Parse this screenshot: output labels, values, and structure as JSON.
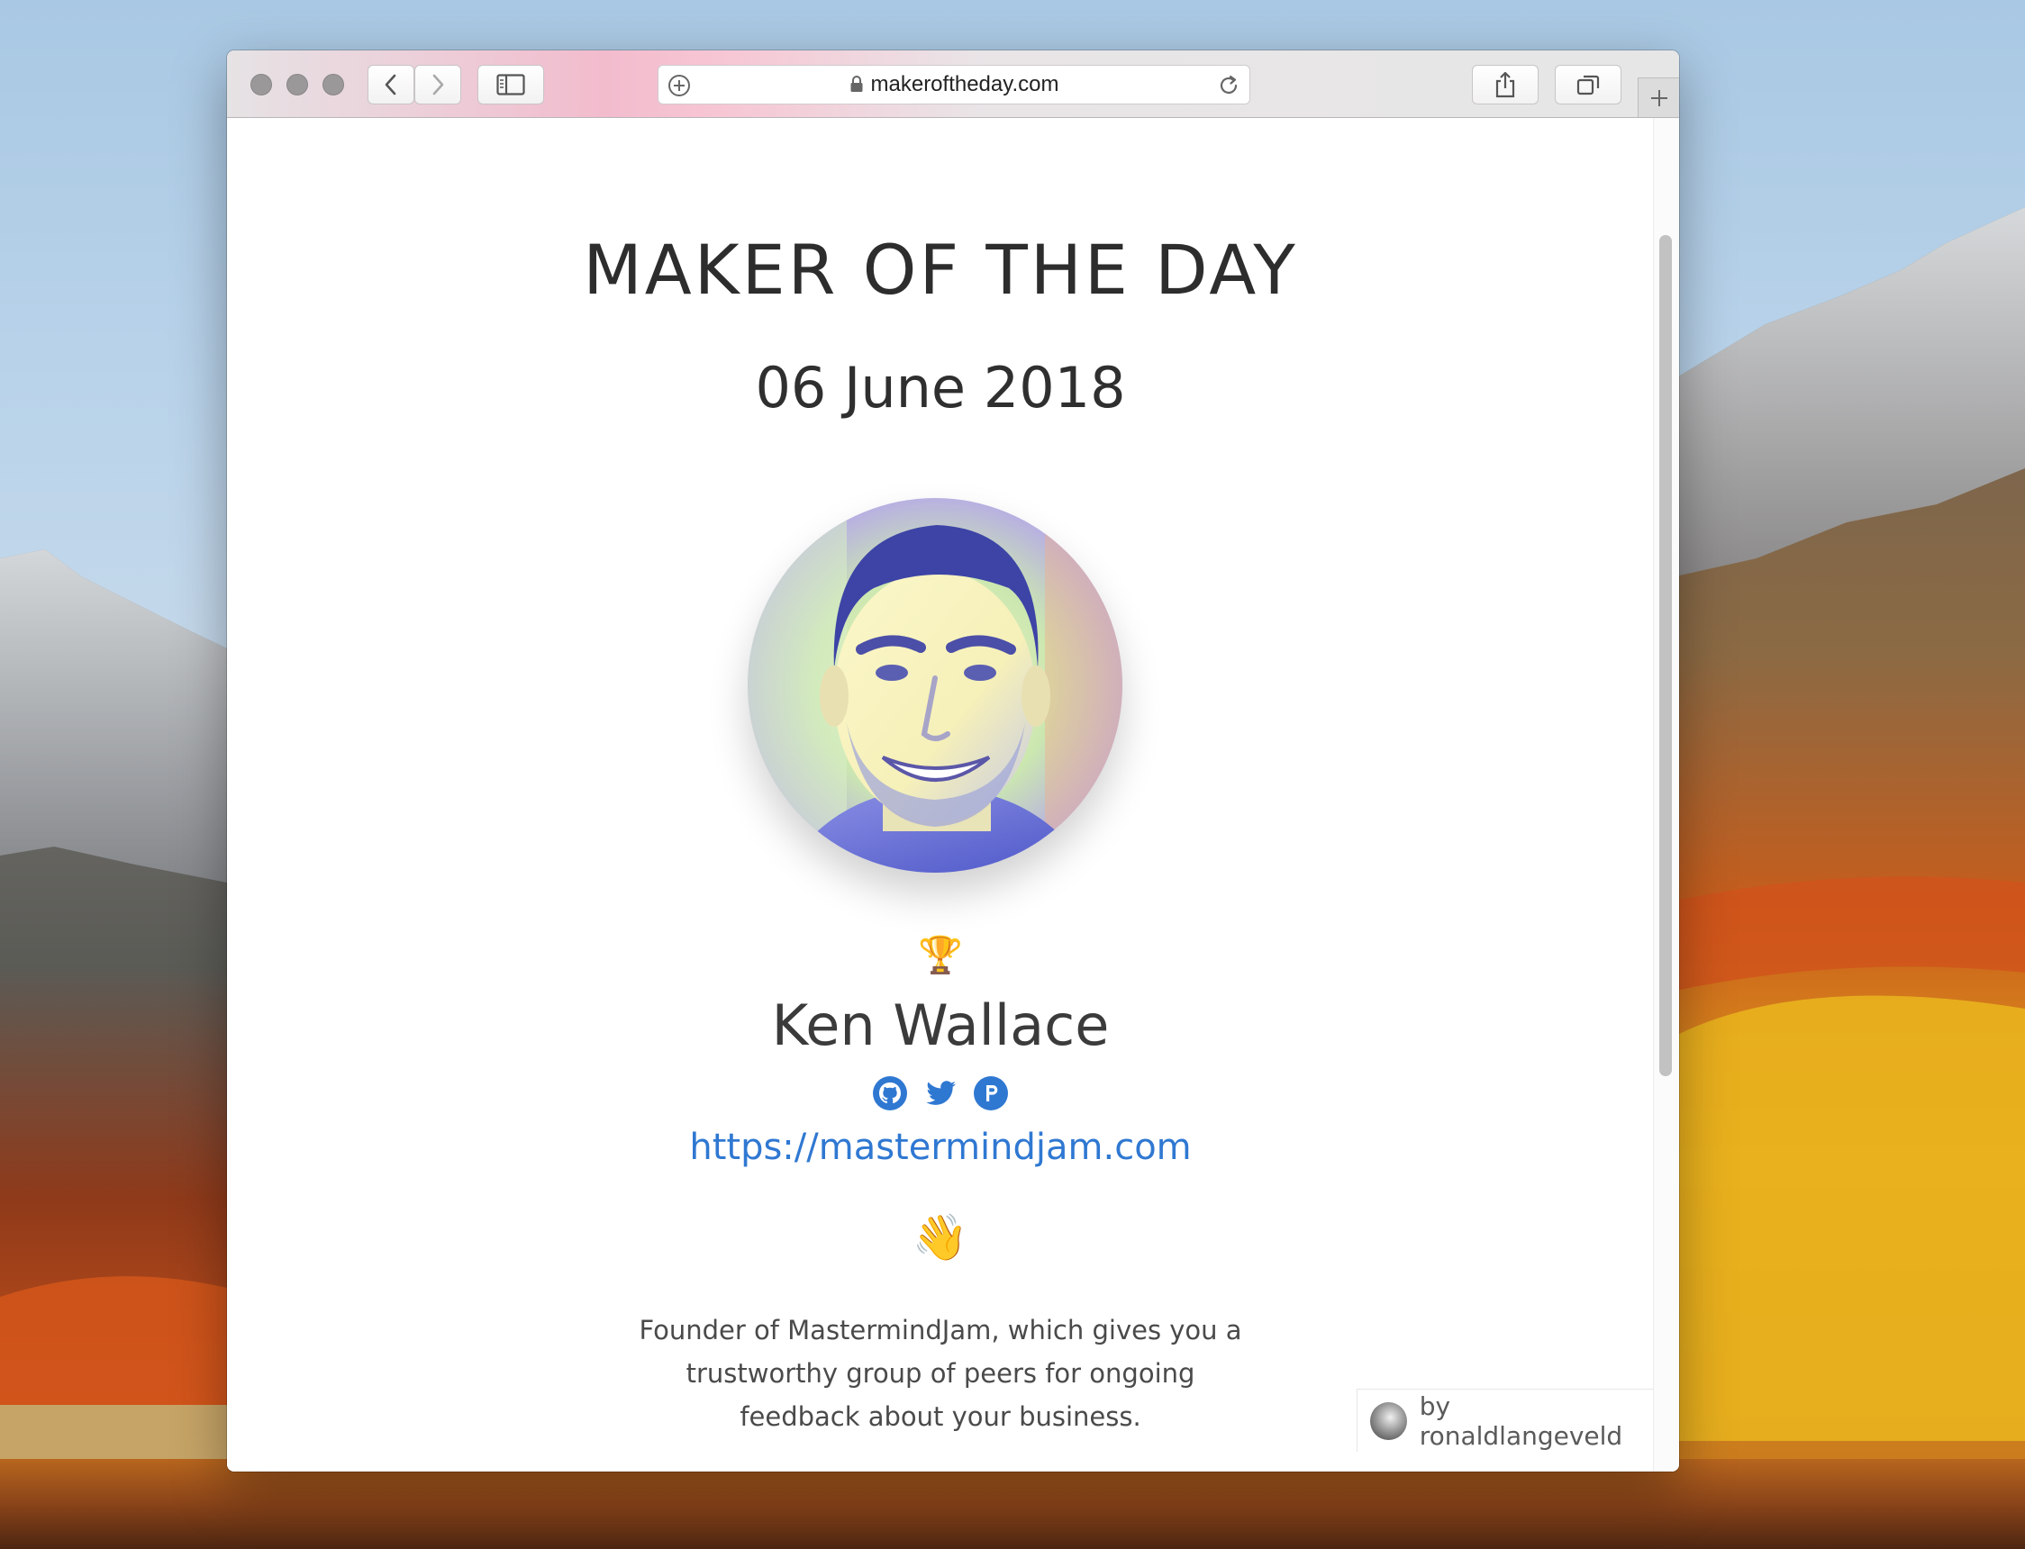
{
  "browser": {
    "url": "makeroftheday.com"
  },
  "page": {
    "title": "MAKER OF THE DAY",
    "date": "06 June 2018",
    "trophy": "🏆",
    "maker_name": "Ken Wallace",
    "maker_link": "https://mastermindjam.com",
    "wave": "👋",
    "bio": "Founder of MastermindJam, which gives you a trustworthy group of peers for ongoing feedback about your business.",
    "credit": "by ronaldlangeveld",
    "socials": [
      "github-icon",
      "twitter-icon",
      "producthunt-icon"
    ]
  },
  "colors": {
    "link": "#2f78d2",
    "social_icon": "#2f78d2",
    "traffic_light": "#9b989a"
  }
}
